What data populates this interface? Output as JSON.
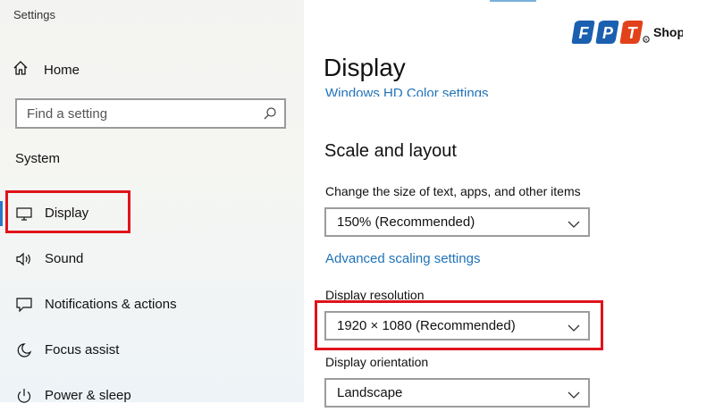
{
  "window": {
    "title": "Settings"
  },
  "sidebar": {
    "home_label": "Home",
    "search_placeholder": "Find a setting",
    "section_title": "System",
    "items": [
      {
        "label": "Display",
        "icon": "monitor-icon",
        "selected": true
      },
      {
        "label": "Sound",
        "icon": "speaker-icon",
        "selected": false
      },
      {
        "label": "Notifications & actions",
        "icon": "message-icon",
        "selected": false
      },
      {
        "label": "Focus assist",
        "icon": "moon-icon",
        "selected": false
      },
      {
        "label": "Power & sleep",
        "icon": "power-icon",
        "selected": false
      }
    ]
  },
  "logo": {
    "letters": [
      "F",
      "P",
      "T"
    ],
    "suffix": "Shop",
    "colors": [
      "#1b5fb0",
      "#1b5fb0",
      "#e2421b"
    ]
  },
  "main": {
    "title": "Display",
    "hdr_link": "Windows HD Color settings",
    "scale_section_title": "Scale and layout",
    "scale_label": "Change the size of text, apps, and other items",
    "scale_value": "150% (Recommended)",
    "advanced_link": "Advanced scaling settings",
    "resolution_label": "Display resolution",
    "resolution_value": "1920 × 1080 (Recommended)",
    "orientation_label": "Display orientation",
    "orientation_value": "Landscape"
  },
  "colors": {
    "accent": "#2878c8",
    "link": "#1f72b8",
    "annotation_red": "#e0141b"
  }
}
